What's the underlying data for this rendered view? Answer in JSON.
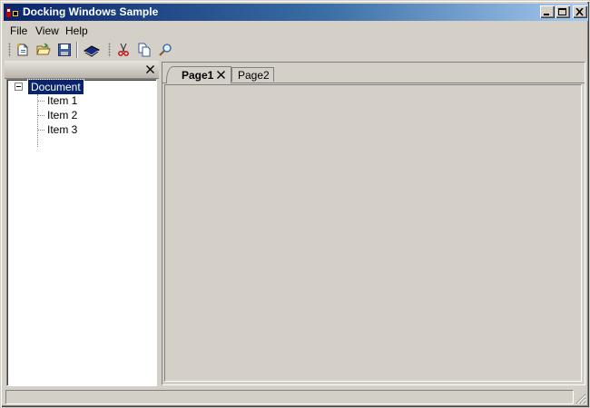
{
  "window": {
    "title": "Docking Windows Sample",
    "accent": "#0a246a",
    "controls": {
      "minimize": "minimize-icon",
      "maximize": "maximize-icon",
      "close": "close-icon"
    }
  },
  "menu": {
    "items": [
      {
        "label": "File"
      },
      {
        "label": "View"
      },
      {
        "label": "Help"
      }
    ]
  },
  "toolbar": {
    "buttons": [
      {
        "icon": "new-document-icon"
      },
      {
        "icon": "open-folder-icon"
      },
      {
        "icon": "save-icon"
      },
      {
        "icon": "book-icon"
      },
      {
        "icon": "cut-icon"
      },
      {
        "icon": "copy-icon"
      },
      {
        "icon": "find-icon"
      }
    ]
  },
  "tree": {
    "root": {
      "label": "Document",
      "expanded": true
    },
    "items": [
      {
        "label": "Item 1"
      },
      {
        "label": "Item 2"
      },
      {
        "label": "Item 3"
      }
    ]
  },
  "tabs": [
    {
      "label": "Page1",
      "active": true
    },
    {
      "label": "Page2",
      "active": false
    }
  ]
}
